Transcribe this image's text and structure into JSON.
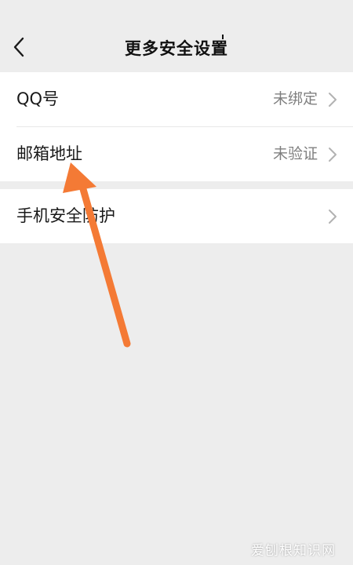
{
  "header": {
    "title": "更多安全设置",
    "back_icon": "chevron-left-icon"
  },
  "settings": {
    "qq": {
      "label": "QQ号",
      "status": "未绑定"
    },
    "email": {
      "label": "邮箱地址",
      "status": "未验证"
    },
    "phone_protection": {
      "label": "手机安全防护"
    }
  },
  "annotation": {
    "arrow_color": "#f47a35",
    "points_to": "邮箱地址"
  },
  "watermark": "爱刨根知识网",
  "colors": {
    "background": "#ededed",
    "row_background": "#ffffff",
    "secondary_text": "#7f7f7f"
  }
}
